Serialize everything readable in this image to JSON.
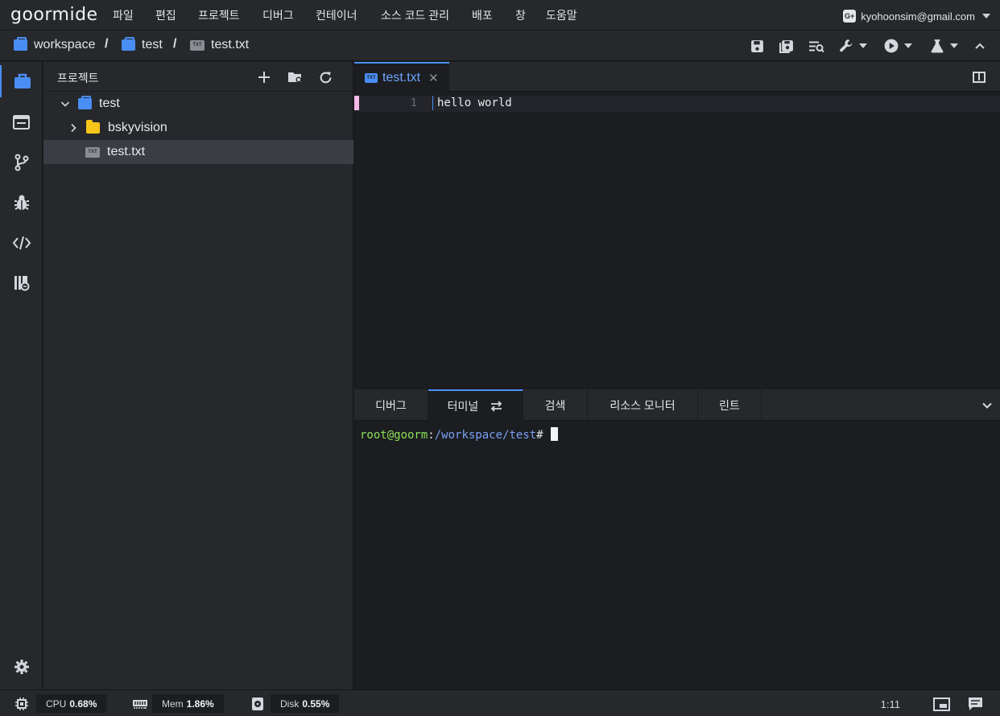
{
  "app": {
    "logo": "goormide"
  },
  "menu": [
    "파일",
    "편집",
    "프로젝트",
    "디버그",
    "컨테이너",
    "소스 코드 관리",
    "배포",
    "창",
    "도움말"
  ],
  "account": {
    "email": "kyohoonsim@gmail.com",
    "provider_badge": "G+"
  },
  "breadcrumb": {
    "root": "workspace",
    "project": "test",
    "file": "test.txt",
    "separator": "/",
    "file_badge": "TXT"
  },
  "explorer": {
    "title": "프로젝트",
    "tree": [
      {
        "label": "test",
        "type": "project",
        "expanded": true
      },
      {
        "label": "bskyvision",
        "type": "folder",
        "expanded": false
      },
      {
        "label": "test.txt",
        "type": "file",
        "selected": true,
        "badge": "TXT"
      }
    ]
  },
  "editor": {
    "tab": {
      "label": "test.txt",
      "close": "✕",
      "badge": "TXT"
    },
    "lines": [
      {
        "number": "1",
        "text": "hello world"
      }
    ]
  },
  "panel": {
    "tabs": [
      "디버그",
      "터미널",
      "검색",
      "리소스 모니터",
      "린트"
    ],
    "active_tab": "터미널",
    "terminal": {
      "user": "root@goorm",
      "colon": ":",
      "path": "/workspace/test",
      "prompt": "#"
    }
  },
  "status": {
    "cpu_label": "CPU",
    "cpu_value": "0.68%",
    "mem_label": "Mem",
    "mem_value": "1.86%",
    "disk_label": "Disk",
    "disk_value": "0.55%",
    "cursor_pos": "1:11"
  },
  "colors": {
    "accent": "#4a8ef5",
    "folder": "#f5c518",
    "terminal_user": "#8ee05a",
    "terminal_path": "#7aa2f7"
  }
}
